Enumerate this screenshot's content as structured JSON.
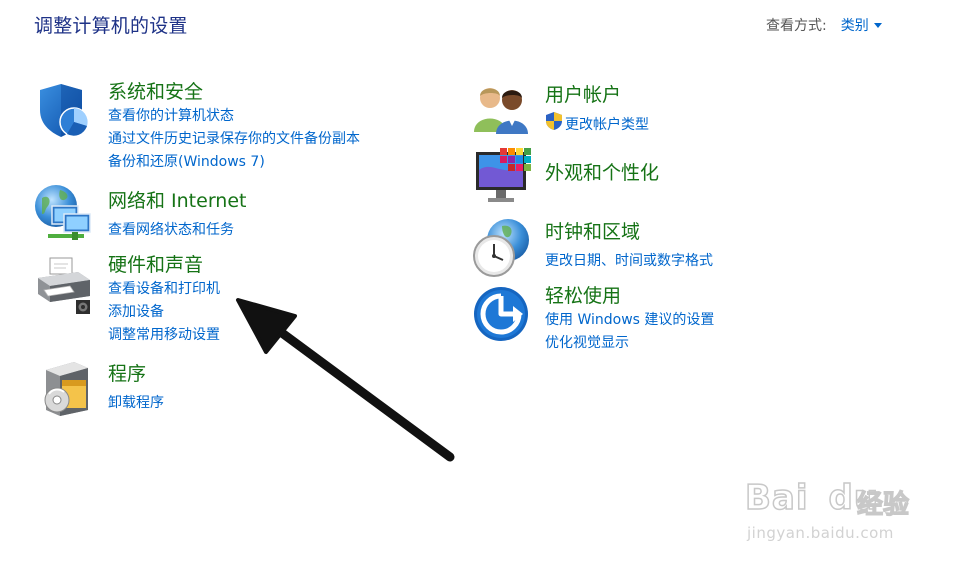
{
  "header": {
    "title": "调整计算机的设置",
    "view_by_label": "查看方式:",
    "view_by_value": "类别"
  },
  "categories": {
    "system": {
      "title": "系统和安全",
      "icon": "shield-icon",
      "links": [
        "查看你的计算机状态",
        "通过文件历史记录保存你的文件备份副本",
        "备份和还原(Windows 7)"
      ]
    },
    "network": {
      "title": "网络和 Internet",
      "icon": "network-globe-icon",
      "links": [
        "查看网络状态和任务"
      ]
    },
    "hardware": {
      "title": "硬件和声音",
      "icon": "printer-icon",
      "links": [
        "查看设备和打印机",
        "添加设备",
        "调整常用移动设置"
      ]
    },
    "programs": {
      "title": "程序",
      "icon": "programs-box-icon",
      "links": [
        "卸载程序"
      ]
    },
    "users": {
      "title": "用户帐户",
      "icon": "users-icon",
      "links": [
        "更改帐户类型"
      ]
    },
    "appearance": {
      "title": "外观和个性化",
      "icon": "monitor-palette-icon",
      "links": []
    },
    "clock": {
      "title": "时钟和区域",
      "icon": "clock-globe-icon",
      "links": [
        "更改日期、时间或数字格式"
      ]
    },
    "ease": {
      "title": "轻松使用",
      "icon": "ease-of-access-icon",
      "links": [
        "使用 Windows 建议的设置",
        "优化视觉显示"
      ]
    }
  },
  "watermark": {
    "brand": "Bai",
    "brand2": "du",
    "cn": "经验",
    "url": "jingyan.baidu.com"
  },
  "colors": {
    "title": "#1e3287",
    "category": "#167316",
    "link": "#0066cc"
  }
}
